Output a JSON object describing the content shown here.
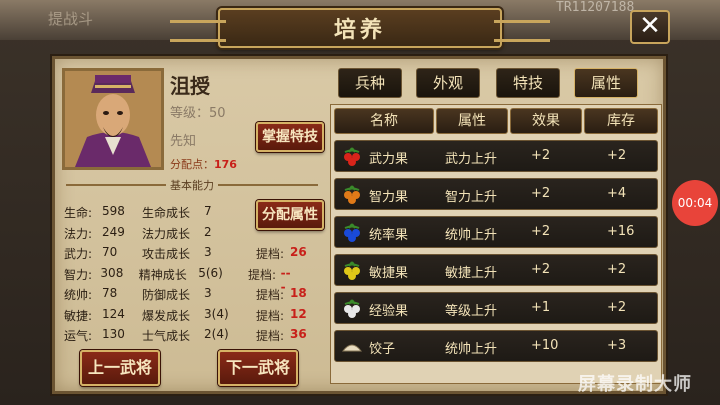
{
  "window": {
    "title": "培养",
    "watermark_top": "TR11207188",
    "bg_text": "提战斗"
  },
  "hero": {
    "name": "沮授",
    "level_label": "等级：50",
    "title": "先知",
    "alloc_label": "分配点：",
    "alloc_value": "176",
    "section_label": "基本能力"
  },
  "buttons": {
    "skill": "掌握特技",
    "alloc": "分配属性",
    "prev": "上一武将",
    "next": "下一武将"
  },
  "tabs": [
    {
      "label": "兵种"
    },
    {
      "label": "外观"
    },
    {
      "label": "特技"
    },
    {
      "label": "属性",
      "active": true
    }
  ],
  "stats": [
    {
      "label": "生命:",
      "value": "598",
      "grow_label": "生命成长",
      "grow_value": "7"
    },
    {
      "label": "法力:",
      "value": "249",
      "grow_label": "法力成长",
      "grow_value": "2"
    },
    {
      "label": "武力:",
      "value": "70",
      "grow_label": "攻击成长",
      "grow_value": "3",
      "tier_label": "提档:",
      "tier_value": "26"
    },
    {
      "label": "智力:",
      "value": "308",
      "grow_label": "精神成长",
      "grow_value": "5(6)",
      "tier_label": "提档:",
      "tier_value": "---"
    },
    {
      "label": "统帅:",
      "value": "78",
      "grow_label": "防御成长",
      "grow_value": "3",
      "tier_label": "提档:",
      "tier_value": "18"
    },
    {
      "label": "敏捷:",
      "value": "124",
      "grow_label": "爆发成长",
      "grow_value": "3(4)",
      "tier_label": "提档:",
      "tier_value": "12"
    },
    {
      "label": "运气:",
      "value": "130",
      "grow_label": "士气成长",
      "grow_value": "2(4)",
      "tier_label": "提档:",
      "tier_value": "36"
    }
  ],
  "table": {
    "headers": [
      "名称",
      "属性",
      "效果",
      "库存"
    ],
    "rows": [
      {
        "icon": "red-fruit-icon",
        "color": "#d8241a",
        "name": "武力果",
        "attr": "武力上升",
        "effect": "+2",
        "stock": "+2"
      },
      {
        "icon": "orange-fruit-icon",
        "color": "#e07a18",
        "name": "智力果",
        "attr": "智力上升",
        "effect": "+2",
        "stock": "+4"
      },
      {
        "icon": "blue-fruit-icon",
        "color": "#1a4ad8",
        "name": "统率果",
        "attr": "统帅上升",
        "effect": "+2",
        "stock": "+16"
      },
      {
        "icon": "yellow-fruit-icon",
        "color": "#e0c818",
        "name": "敏捷果",
        "attr": "敏捷上升",
        "effect": "+2",
        "stock": "+2"
      },
      {
        "icon": "white-fruit-icon",
        "color": "#e8e8e8",
        "name": "经验果",
        "attr": "等级上升",
        "effect": "+1",
        "stock": "+2"
      },
      {
        "icon": "dumpling-icon",
        "color": "#e8dcc0",
        "name": "饺子",
        "attr": "统帅上升",
        "effect": "+10",
        "stock": "+3"
      }
    ]
  },
  "overlay": {
    "timer": "00:04",
    "watermark": "屏幕录制大师"
  }
}
